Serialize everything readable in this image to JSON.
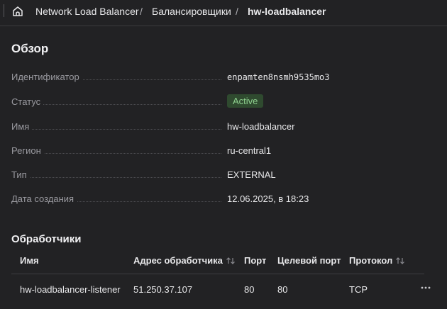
{
  "breadcrumb": {
    "items": [
      "Network Load Balancer",
      "Балансировщики",
      "hw-loadbalancer"
    ],
    "separator": "/"
  },
  "overview": {
    "title": "Обзор",
    "rows": [
      {
        "label": "Идентификатор",
        "value": "enpamten8nsmh9535mo3"
      },
      {
        "label": "Статус",
        "value": "Active"
      },
      {
        "label": "Имя",
        "value": "hw-loadbalancer"
      },
      {
        "label": "Регион",
        "value": "ru-central1"
      },
      {
        "label": "Тип",
        "value": "EXTERNAL"
      },
      {
        "label": "Дата создания",
        "value": "12.06.2025, в 18:23"
      }
    ]
  },
  "listeners": {
    "title": "Обработчики",
    "columns": [
      "Имя",
      "Адрес обработчика",
      "Порт",
      "Целевой порт",
      "Протокол"
    ],
    "rows": [
      [
        "hw-loadbalancer-listener",
        "51.250.37.107",
        "80",
        "80",
        "TCP"
      ]
    ]
  },
  "colors": {
    "background": "#222224",
    "status_active_bg": "#2f4a2f",
    "status_active_text": "#8fd18f"
  }
}
